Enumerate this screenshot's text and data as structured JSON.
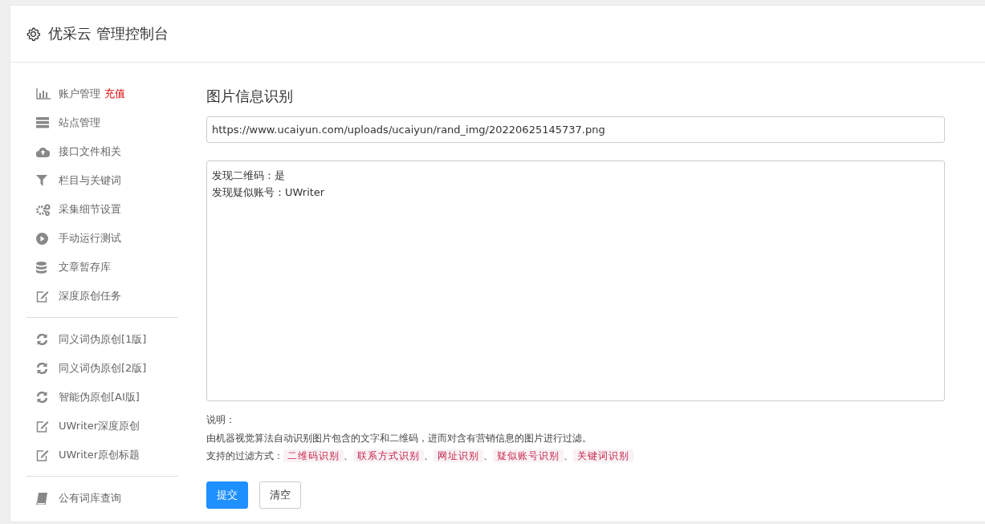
{
  "header": {
    "title": "优采云 管理控制台"
  },
  "sidebar": {
    "groups": [
      {
        "items": [
          {
            "label": "账户管理",
            "badge": "充值"
          },
          {
            "label": "站点管理"
          },
          {
            "label": "接口文件相关"
          },
          {
            "label": "栏目与关键词"
          },
          {
            "label": "采集细节设置"
          },
          {
            "label": "手动运行测试"
          },
          {
            "label": "文章暂存库"
          },
          {
            "label": "深度原创任务"
          }
        ]
      },
      {
        "items": [
          {
            "label": "同义词伪原创[1版]"
          },
          {
            "label": "同义词伪原创[2版]"
          },
          {
            "label": "智能伪原创[AI版]"
          },
          {
            "label": "UWriter深度原创"
          },
          {
            "label": "UWriter原创标题"
          }
        ]
      },
      {
        "items": [
          {
            "label": "公有词库查询"
          }
        ]
      }
    ]
  },
  "main": {
    "title": "图片信息识别",
    "url_field": {
      "value": "https://www.ucaiyun.com/uploads/ucaiyun/rand_img/20220625145737.png"
    },
    "result_lines": [
      "发现二维码：是",
      "发现疑似账号：UWriter"
    ],
    "notes": {
      "heading": "说明：",
      "description": "由机器视觉算法自动识别图片包含的文字和二维码，进而对含有营销信息的图片进行过滤。",
      "filters_label": "支持的过滤方式：",
      "separator": "、",
      "filters": [
        "二维码识别",
        "联系方式识别",
        "网址识别",
        "疑似账号识别",
        "关键词识别"
      ]
    },
    "buttons": [
      {
        "label": "提交",
        "kind": "primary"
      },
      {
        "label": "清空",
        "kind": "default"
      }
    ]
  }
}
